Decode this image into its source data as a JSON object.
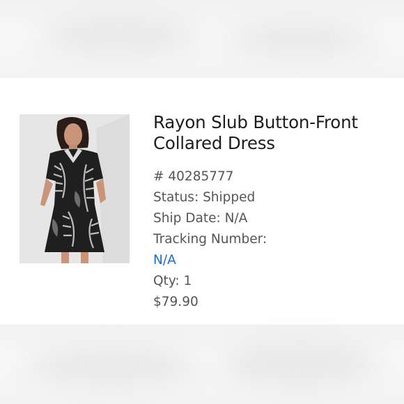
{
  "product": {
    "title_line1": "Rayon Slub Button-Front",
    "title_line2": "Collared Dress",
    "image_alt": "Model wearing black tropical leaf print collared dress"
  },
  "order": {
    "number": "# 40285777",
    "status": "Status: Shipped",
    "ship_date": "Ship Date: N/A",
    "tracking_label": "Tracking Number:",
    "tracking_value": "N/A",
    "qty": "Qty: 1",
    "price": "$79.90"
  },
  "colors": {
    "link": "#1a6fc9",
    "text_primary": "#1d1d1d",
    "text_secondary": "#555555"
  }
}
